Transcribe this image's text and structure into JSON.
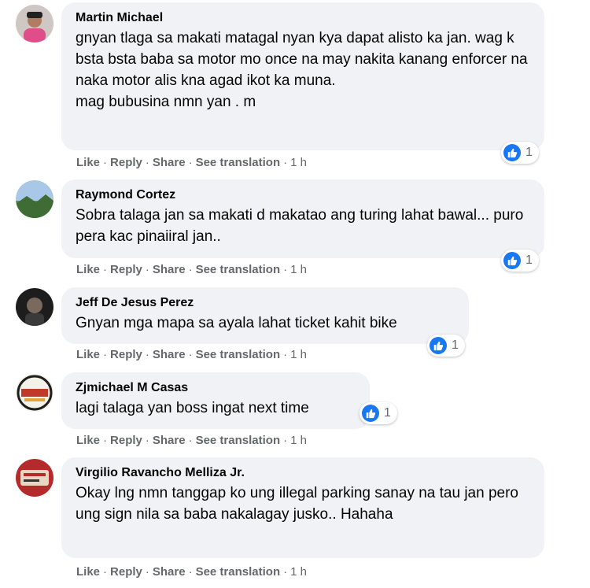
{
  "actions": {
    "like": "Like",
    "reply": "Reply",
    "share": "Share",
    "translate": "See translation",
    "separator": "·"
  },
  "comments": [
    {
      "author": "Martin Michael",
      "text": "gnyan tlaga sa makati matagal nyan kya dapat alisto ka jan. wag k\nbsta bsta baba sa motor mo once na may nakita kanang enforcer na naka motor alis kna agad ikot ka muna.\nmag bubusina nmn yan . m",
      "reactions": "1",
      "time": "1 h",
      "avatar_color": "#e04e8a"
    },
    {
      "author": "Raymond Cortez",
      "text": "Sobra talaga jan sa makati d makatao ang turing lahat bawal... puro pera kac pinaiiral jan..",
      "reactions": "1",
      "time": "1 h",
      "avatar_color": "#5f8a4a"
    },
    {
      "author": "Jeff De Jesus Perez",
      "text": "Gnyan mga mapa sa ayala lahat ticket kahit bike",
      "reactions": "1",
      "time": "1 h",
      "avatar_color": "#2b2b2b"
    },
    {
      "author": "Zjmichael M Casas",
      "text": "lagi talaga yan boss ingat next time",
      "reactions": "1",
      "time": "1 h",
      "avatar_color": "#c0392b"
    },
    {
      "author": "Virgilio Ravancho Melliza Jr.",
      "text": "Okay lng nmn tanggap ko ung illegal parking sanay na tau jan pero ung sign nila sa baba nakalagay jusko.. Hahaha",
      "reactions": "",
      "time": "1 h",
      "avatar_color": "#b52a2a"
    }
  ]
}
